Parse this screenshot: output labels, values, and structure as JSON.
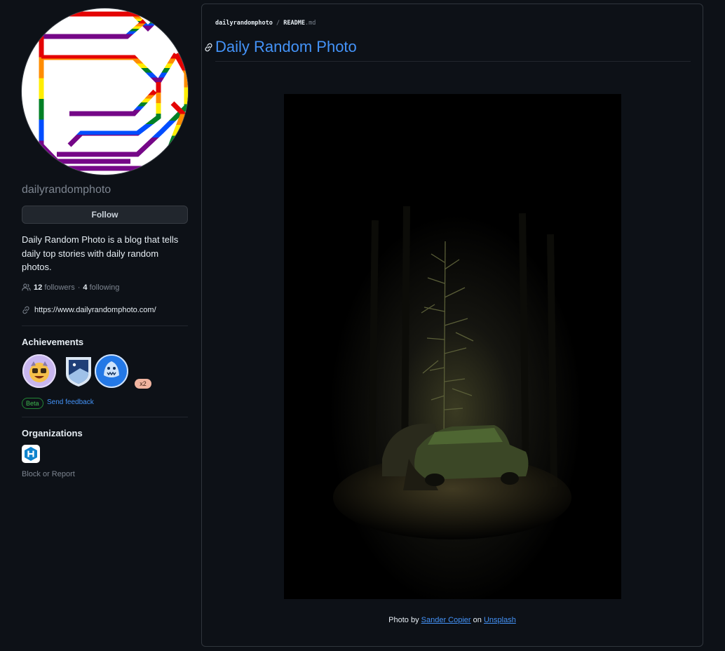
{
  "profile": {
    "username": "dailyrandomphoto",
    "follow_label": "Follow",
    "bio": "Daily Random Photo is a blog that tells daily top stories with daily random photos.",
    "followers_count": "12",
    "followers_label": "followers",
    "separator": "·",
    "following_count": "4",
    "following_label": "following",
    "website": "https://www.dailyrandomphoto.com/"
  },
  "achievements": {
    "title": "Achievements",
    "badges": [
      {
        "name": "starstruck-badge"
      },
      {
        "name": "arctic-code-vault-badge"
      },
      {
        "name": "pull-shark-badge",
        "count": "x2"
      }
    ],
    "beta_label": "Beta",
    "feedback_label": "Send feedback"
  },
  "organizations": {
    "title": "Organizations",
    "block_label": "Block or Report"
  },
  "readme": {
    "repo": "dailyrandomphoto",
    "slash": "/",
    "file": "README",
    "ext": ".md",
    "title": "Daily Random Photo",
    "caption_prefix": "Photo by",
    "photographer": "Sander Copier",
    "caption_middle": "on",
    "source": "Unsplash"
  },
  "colors": {
    "background": "#0d1117",
    "link": "#4493f8",
    "muted": "#7d8590",
    "border": "#30363d"
  }
}
